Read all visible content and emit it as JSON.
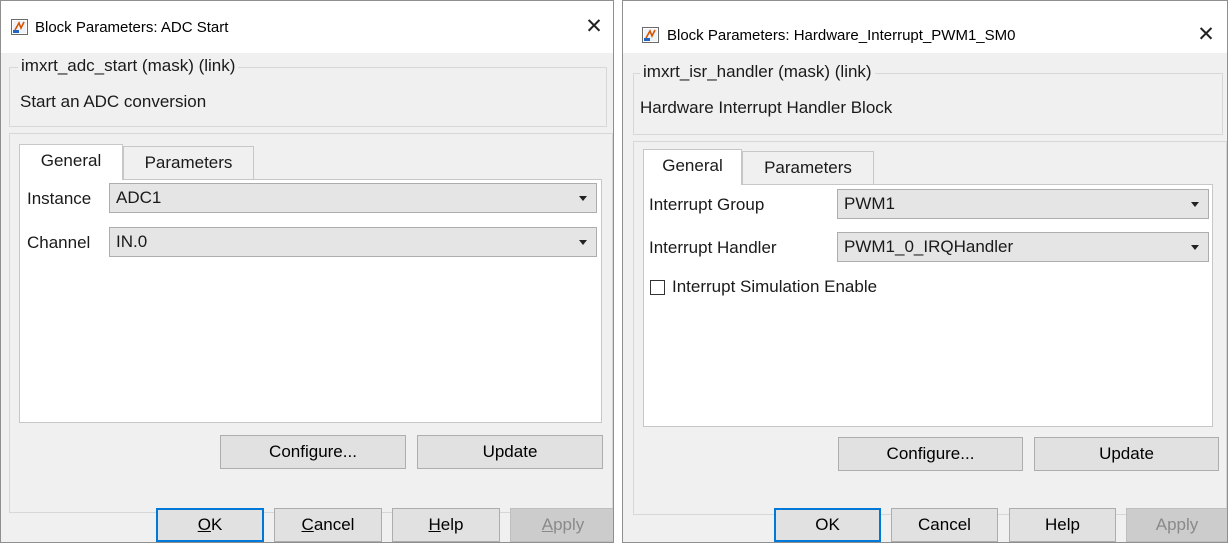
{
  "left_dialog": {
    "title": "Block Parameters: ADC Start",
    "mask_group": "imxrt_adc_start (mask) (link)",
    "description": "Start an ADC conversion",
    "tabs": [
      {
        "label": "General"
      },
      {
        "label": "Parameters"
      }
    ],
    "fields": [
      {
        "label": "Instance",
        "value": "ADC1"
      },
      {
        "label": "Channel",
        "value": "IN.0"
      }
    ],
    "panel_buttons": {
      "configure": "Configure...",
      "update": "Update"
    },
    "footer": {
      "ok_u": "O",
      "ok_rest": "K",
      "cancel_u": "C",
      "cancel_rest": "ancel",
      "help_u": "H",
      "help_rest": "elp",
      "apply_u": "A",
      "apply_rest": "pply"
    }
  },
  "right_dialog": {
    "title": "Block Parameters: Hardware_Interrupt_PWM1_SM0",
    "mask_group": "imxrt_isr_handler (mask) (link)",
    "description": "Hardware Interrupt Handler Block",
    "tabs": [
      {
        "label": "General"
      },
      {
        "label": "Parameters"
      }
    ],
    "fields": [
      {
        "label": "Interrupt Group",
        "value": "PWM1"
      },
      {
        "label": "Interrupt Handler",
        "value": "PWM1_0_IRQHandler"
      }
    ],
    "checkbox": {
      "label": "Interrupt Simulation Enable",
      "checked": false
    },
    "panel_buttons": {
      "configure": "Configure...",
      "update": "Update"
    },
    "footer": {
      "ok": "OK",
      "cancel": "Cancel",
      "help": "Help",
      "apply": "Apply"
    }
  },
  "icons": {
    "app": "simulink-block-icon",
    "close": "close-icon"
  },
  "colors": {
    "default_button_border": "#0078d7",
    "dialog_bg": "#f0f0f0"
  }
}
